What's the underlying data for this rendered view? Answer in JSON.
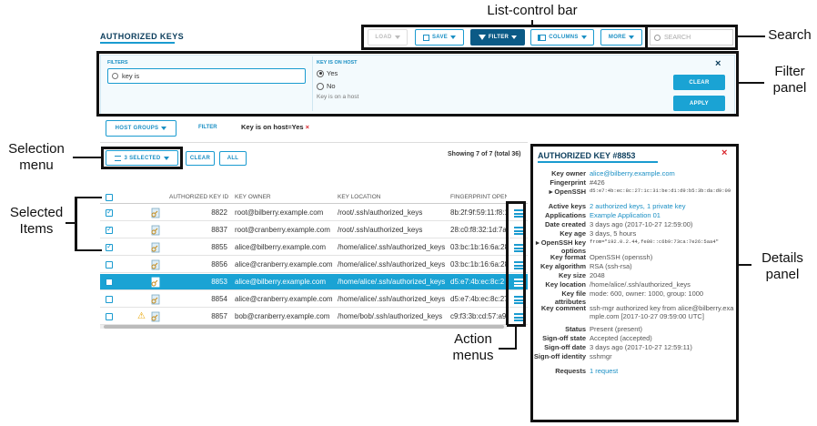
{
  "callouts": {
    "list_control_bar": "List-control bar",
    "search": "Search",
    "filter_panel": "Filter\npanel",
    "selection_menu": "Selection\nmenu",
    "selected_items": "Selected\nItems",
    "action_menus": "Action\nmenus",
    "details_panel": "Details\npanel"
  },
  "page_title": "AUTHORIZED KEYS",
  "toolbar": {
    "load": "LOAD",
    "save": "SAVE",
    "filter": "FILTER",
    "columns": "COLUMNS",
    "more": "MORE",
    "search_placeholder": "SEARCH"
  },
  "filter_panel": {
    "filters_label": "FILTERS",
    "filter_input_value": "key is",
    "key_on_host_label": "KEY IS ON HOST",
    "opt_yes": "Yes",
    "opt_no": "No",
    "hint": "Key is on a host",
    "close": "×",
    "clear": "CLEAR",
    "apply": "APPLY"
  },
  "filter_bar": {
    "host_groups": "HOST GROUPS",
    "filter": "FILTER",
    "active_filter": "Key is on host=Yes",
    "remove": "×"
  },
  "selection": {
    "selected": "3 SELECTED",
    "clear": "CLEAR",
    "all": "ALL",
    "showing": "Showing 7 of 7 (total 36)"
  },
  "table": {
    "columns": [
      "AUTHORIZED KEY ID",
      "KEY OWNER",
      "KEY LOCATION",
      "FINGERPRINT OPENS"
    ],
    "rows": [
      {
        "id": "8822",
        "owner": "root@bilberry.example.com",
        "location": "/root/.ssh/authorized_keys",
        "fp": "8b:2f:9f:59:11:f8:1",
        "checked": true,
        "warn": false,
        "selected": false
      },
      {
        "id": "8837",
        "owner": "root@cranberry.example.com",
        "location": "/root/.ssh/authorized_keys",
        "fp": "28:c0:f8:32:1d:7a",
        "checked": true,
        "warn": false,
        "selected": false
      },
      {
        "id": "8855",
        "owner": "alice@bilberry.example.com",
        "location": "/home/alice/.ssh/authorized_keys",
        "fp": "03:bc:1b:16:6a:28",
        "checked": true,
        "warn": false,
        "selected": false
      },
      {
        "id": "8856",
        "owner": "alice@cranberry.example.com",
        "location": "/home/alice/.ssh/authorized_keys",
        "fp": "03:bc:1b:16:6a:28",
        "checked": false,
        "warn": false,
        "selected": false
      },
      {
        "id": "8853",
        "owner": "alice@bilberry.example.com",
        "location": "/home/alice/.ssh/authorized_keys",
        "fp": "d5:e7:4b:ec:8c:2",
        "checked": false,
        "warn": false,
        "selected": true
      },
      {
        "id": "8854",
        "owner": "alice@cranberry.example.com",
        "location": "/home/alice/.ssh/authorized_keys",
        "fp": "d5:e7:4b:ec:8c:27",
        "checked": false,
        "warn": false,
        "selected": false
      },
      {
        "id": "8857",
        "owner": "bob@cranberry.example.com",
        "location": "/home/bob/.ssh/authorized_keys",
        "fp": "c9:f3:3b:cd:57:a9",
        "checked": false,
        "warn": true,
        "selected": false
      }
    ]
  },
  "details": {
    "title": "AUTHORIZED KEY #8853",
    "close": "×",
    "rows": [
      {
        "k": "Key owner",
        "v": "alice@bilberry.example.com",
        "link": true
      },
      {
        "k": "Fingerprint",
        "v": "#426",
        "link": false
      },
      {
        "k": "▸ OpenSSH",
        "v": "d5:e7:4b:ec:8c:27:1c:31:be:d1:d9:b5:3b:da:d9:09",
        "mono": true
      },
      {
        "k": "Active keys",
        "v": "2 authorized keys, 1 private key",
        "link": true
      },
      {
        "k": "Applications",
        "v": "Example Application 01",
        "link": true
      },
      {
        "k": "Date created",
        "v": "3 days ago (2017-10-27 12:59:00)"
      },
      {
        "k": "Key age",
        "v": "3 days, 5 hours"
      },
      {
        "k": "▸ OpenSSH key options",
        "v": "from=\"192.0.2.44,fe80::c6b9:73ca:7e26:5aa4\"",
        "mono": true
      },
      {
        "k": "Key format",
        "v": "OpenSSH (openssh)"
      },
      {
        "k": "Key algorithm",
        "v": "RSA (ssh-rsa)"
      },
      {
        "k": "Key size",
        "v": "2048"
      },
      {
        "k": "Key location",
        "v": "/home/alice/.ssh/authorized_keys"
      },
      {
        "k": "Key file attributes",
        "v": "mode: 600, owner: 1000, group: 1000"
      },
      {
        "k": "Key comment",
        "v": "ssh-mgr authorized key from alice@bilberry.example.com [2017-10-27 09:59:00 UTC]"
      },
      {
        "k": "Status",
        "v": "Present (present)"
      },
      {
        "k": "Sign-off state",
        "v": "Accepted (accepted)"
      },
      {
        "k": "Sign-off date",
        "v": "3 days ago (2017-10-27 12:59:11)"
      },
      {
        "k": "Sign-off identity",
        "v": "sshmgr"
      },
      {
        "k": "Requests",
        "v": "1 request",
        "link": true
      }
    ]
  },
  "colors": {
    "accent": "#1a9bd0",
    "dark": "#0b5a86",
    "selected_row": "#1aa3d4",
    "panel_bg": "#f3fafd",
    "close": "#d9262c"
  }
}
